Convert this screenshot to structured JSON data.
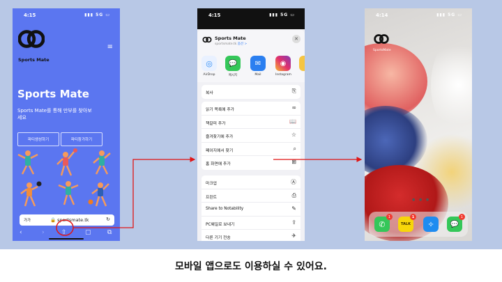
{
  "caption": "모바일 앱으로도 이용하실 수 있어요.",
  "phone1": {
    "time": "4:15",
    "signal": "5G",
    "brand": "Sports Mate",
    "hero_title": "Sports Mate",
    "hero_desc": "Sports Mate를 통해 만부를 찾아보세요",
    "button1": "파티생성하기",
    "button2": "파티참가하기",
    "url_aa": "가가",
    "url": "sportsmate.tk"
  },
  "phone2": {
    "time": "4:15",
    "signal": "5G",
    "sheet_title": "Sports Mate",
    "sheet_sub": "sportsmate.tk",
    "sheet_options": "옵션 >",
    "apps": [
      {
        "label": "AirDrop",
        "color": "#2f8cf5",
        "icon": "airdrop-icon"
      },
      {
        "label": "메시지",
        "color": "#34c759",
        "icon": "messages-icon"
      },
      {
        "label": "Mail",
        "color": "#2b7ff0",
        "icon": "mail-icon"
      },
      {
        "label": "Instagram",
        "color": "#e1306c",
        "icon": "instagram-icon"
      },
      {
        "label": "A",
        "color": "#f5c542",
        "icon": "app-icon"
      }
    ],
    "group1": [
      {
        "label": "복사",
        "icon": "copy-icon"
      }
    ],
    "group2": [
      {
        "label": "읽기 목록에 추가",
        "icon": "glasses-icon"
      },
      {
        "label": "책갈피 추가",
        "icon": "book-icon"
      },
      {
        "label": "즐겨찾기에 추가",
        "icon": "star-icon"
      },
      {
        "label": "페이지에서 찾기",
        "icon": "search-icon"
      },
      {
        "label": "홈 화면에 추가",
        "icon": "add-square-icon"
      }
    ],
    "group3": [
      {
        "label": "마크업",
        "icon": "markup-icon"
      },
      {
        "label": "프린트",
        "icon": "print-icon"
      },
      {
        "label": "Share to Notability",
        "icon": "pencil-icon"
      },
      {
        "label": "PC웨일로 보내기",
        "icon": "send-icon"
      },
      {
        "label": "다른 기기 전송",
        "icon": "bird-icon"
      }
    ]
  },
  "phone3": {
    "time": "4:14",
    "signal": "5G",
    "home_app_label": "SportsMate",
    "dock": [
      {
        "name": "phone-app",
        "color": "#34c759",
        "badge": "1"
      },
      {
        "name": "kakaotalk-app",
        "color": "#f7d60a",
        "badge": "1",
        "text": "TALK"
      },
      {
        "name": "safari-app",
        "color": "#1f8cf0",
        "badge": ""
      },
      {
        "name": "messages-app",
        "color": "#34c759",
        "badge": "1"
      }
    ]
  },
  "colors": {
    "band": "#b8c8e6",
    "phone1_bg": "#5b76f0",
    "highlight": "#e01515"
  }
}
